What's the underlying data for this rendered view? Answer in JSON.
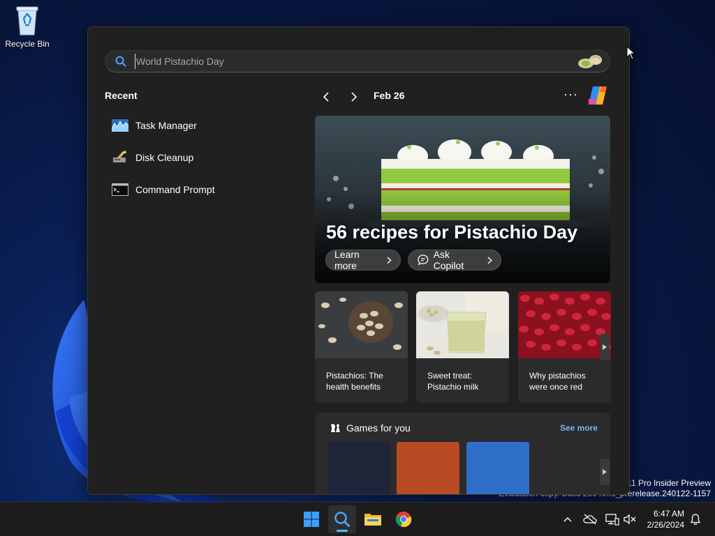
{
  "desktop": {
    "recycle_bin_label": "Recycle Bin",
    "watermark_line1": "s 11 Pro Insider Preview",
    "watermark_line2": "Evaluation copy. Build 26040.rs_prerelease.240122-1157"
  },
  "search": {
    "placeholder": "World Pistachio Day",
    "value": ""
  },
  "recent": {
    "title": "Recent",
    "items": [
      {
        "label": "Task Manager",
        "icon": "task-manager-icon"
      },
      {
        "label": "Disk Cleanup",
        "icon": "disk-cleanup-icon"
      },
      {
        "label": "Command Prompt",
        "icon": "command-prompt-icon"
      }
    ]
  },
  "highlights": {
    "date": "Feb 26",
    "more": "···",
    "hero": {
      "title": "56 recipes for Pistachio Day",
      "learn_more": "Learn more",
      "ask_copilot": "Ask Copilot"
    },
    "cards": [
      {
        "label": "Pistachios: The health benefits"
      },
      {
        "label": "Sweet treat: Pistachio milk"
      },
      {
        "label": "Why pistachios were once red"
      }
    ],
    "games": {
      "title": "Games for you",
      "see_more": "See more",
      "tile_colors": [
        "#1f2438",
        "#b84a24",
        "#2f6ec9"
      ]
    }
  },
  "taskbar": {
    "time": "6:47 AM",
    "date": "2/26/2024",
    "accent": "#4cc2ff"
  }
}
